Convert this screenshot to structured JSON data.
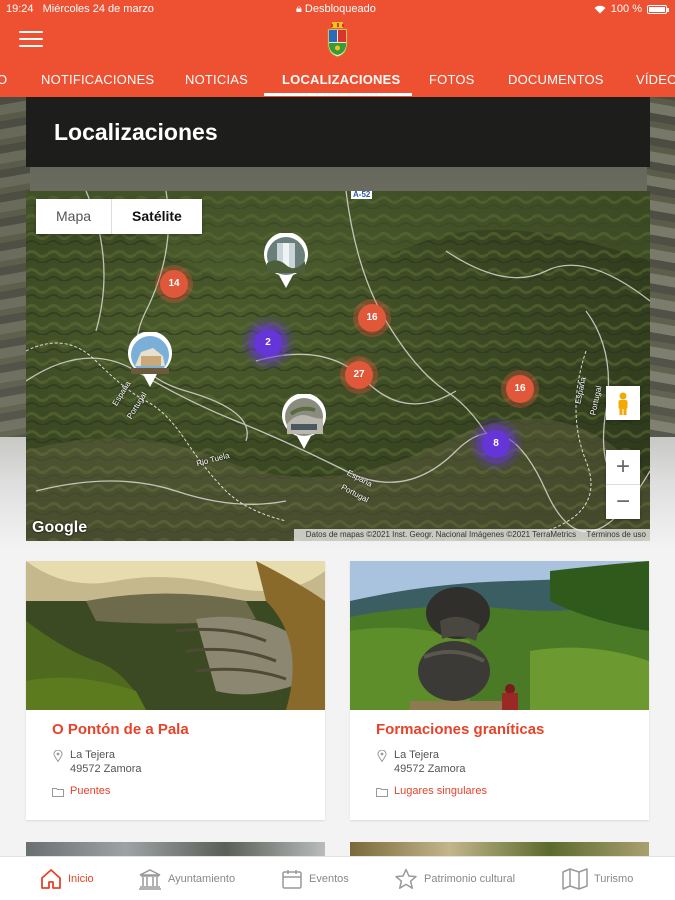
{
  "status": {
    "time": "19:24",
    "date": "Miércoles 24 de marzo",
    "lock_text": "Desbloqueado",
    "battery": "100 %"
  },
  "tabs": [
    {
      "label": "O"
    },
    {
      "label": "NOTIFICACIONES"
    },
    {
      "label": "NOTICIAS"
    },
    {
      "label": "LOCALIZACIONES"
    },
    {
      "label": "FOTOS"
    },
    {
      "label": "DOCUMENTOS"
    },
    {
      "label": "VÍDEO"
    }
  ],
  "active_tab": "LOCALIZACIONES",
  "page_title": "Localizaciones",
  "map": {
    "type_options": [
      "Mapa",
      "Satélite"
    ],
    "selected_type": "Satélite",
    "clusters": [
      {
        "count": "14",
        "color": "orange"
      },
      {
        "count": "16",
        "color": "orange"
      },
      {
        "count": "2",
        "color": "purple"
      },
      {
        "count": "27",
        "color": "orange"
      },
      {
        "count": "16",
        "color": "orange"
      },
      {
        "count": "8",
        "color": "purple"
      }
    ],
    "road_shield": "A-52",
    "labels": [
      "España",
      "Portugal",
      "España",
      "Portugal",
      "España",
      "Portugal",
      "Rio Tuela"
    ],
    "google_logo": "Google",
    "attribution": "Datos de mapas ©2021 Inst. Geogr. Nacional Imágenes ©2021 TerraMetrics",
    "terms": "Términos de uso",
    "zoom_in": "+",
    "zoom_out": "−"
  },
  "cards": [
    {
      "title": "O Pontón de a Pala",
      "address_line1": "La Tejera",
      "address_line2": "49572 Zamora",
      "category": "Puentes"
    },
    {
      "title": "Formaciones graníticas",
      "address_line1": "La Tejera",
      "address_line2": "49572 Zamora",
      "category": "Lugares singulares"
    }
  ],
  "bottom_nav": [
    {
      "label": "Inicio",
      "icon": "home-icon",
      "active": true
    },
    {
      "label": "Ayuntamiento",
      "icon": "town-hall-icon",
      "active": false
    },
    {
      "label": "Eventos",
      "icon": "calendar-icon",
      "active": false
    },
    {
      "label": "Patrimonio cultural",
      "icon": "star-icon",
      "active": false
    },
    {
      "label": "Turismo",
      "icon": "map-icon",
      "active": false
    }
  ],
  "colors": {
    "brand": "#ee5032",
    "accent_text": "#e6432a",
    "cluster_orange": "#e0573a",
    "cluster_purple": "#6535d8"
  }
}
